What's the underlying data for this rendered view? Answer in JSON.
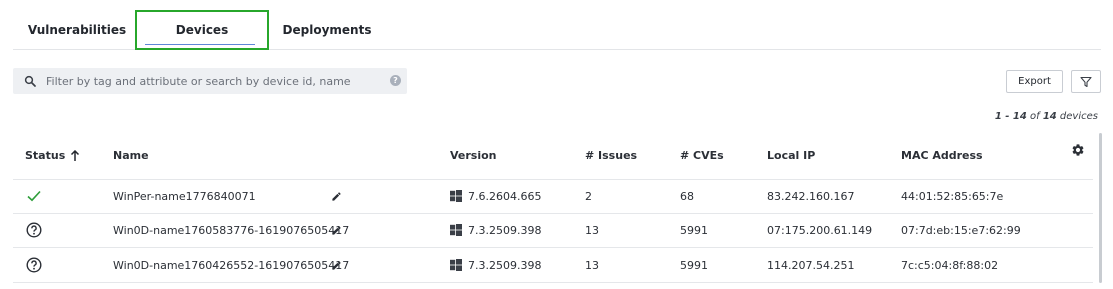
{
  "tabs": [
    {
      "label": "Vulnerabilities"
    },
    {
      "label": "Devices"
    },
    {
      "label": "Deployments"
    }
  ],
  "search": {
    "placeholder": "Filter by tag and attribute or search by device id, name",
    "value": ""
  },
  "toolbar": {
    "export_label": "Export"
  },
  "pagination": {
    "range": "1 - 14",
    "of": " of ",
    "total": "14",
    "suffix": " devices"
  },
  "table": {
    "headers": {
      "status": "Status",
      "name": "Name",
      "version": "Version",
      "issues": "# Issues",
      "cves": "# CVEs",
      "local_ip": "Local IP",
      "mac": "MAC Address"
    },
    "rows": [
      {
        "status": "ok",
        "name": "WinPer-name1776840071",
        "version": "7.6.2604.665",
        "issues": "2",
        "cves": "68",
        "local_ip": "83.242.160.167",
        "mac": "44:01:52:85:65:7e"
      },
      {
        "status": "unknown",
        "name": "Win0D-name1760583776-1619076505417",
        "version": "7.3.2509.398",
        "issues": "13",
        "cves": "5991",
        "local_ip": "07:175.200.61.149",
        "mac": "07:7d:eb:15:e7:62:99"
      },
      {
        "status": "unknown",
        "name": "Win0D-name1760426552-1619076505417",
        "version": "7.3.2509.398",
        "issues": "13",
        "cves": "5991",
        "local_ip": "114.207.54.251",
        "mac": "7c:c5:04:8f:88:02"
      }
    ]
  },
  "colors": {
    "active_tab_border": "#27a72b",
    "ok_check": "#2e9e3a",
    "tab_underline": "#5f87d8"
  },
  "icons": {
    "search": "search-icon",
    "help": "help-icon",
    "filter": "filter-icon",
    "sort": "arrow-up-icon",
    "settings": "gear-icon",
    "edit": "pencil-icon",
    "os": "windows-icon",
    "ok": "check-icon",
    "unknown": "question-circle-icon"
  }
}
